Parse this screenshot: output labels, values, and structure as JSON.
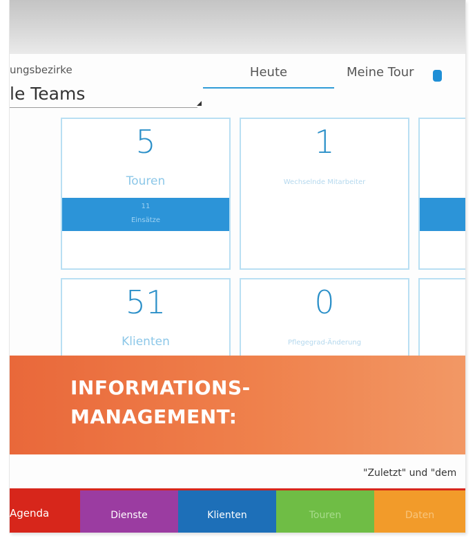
{
  "filter": {
    "label": "ungsbezirke",
    "value": "le Teams"
  },
  "tabs": {
    "heute": "Heute",
    "meine_tour": "Meine Tour"
  },
  "tiles": [
    {
      "number": "5",
      "label": "Touren",
      "band_line1": "11",
      "band_line2": "Einsätze"
    },
    {
      "number": "1",
      "label": "Wechselnde Mitarbeiter"
    },
    {
      "number": "51",
      "label": "Klienten"
    },
    {
      "number": "0",
      "label": "Pflegegrad-Änderung"
    }
  ],
  "banner": {
    "line1": "INFORMATIONS-",
    "line2": "MANAGEMENT:"
  },
  "note": "\"Zuletzt\" und \"dem",
  "nav": {
    "agenda": "Agenda",
    "dienste": "Dienste",
    "klienten": "Klienten",
    "touren": "Touren",
    "daten": "Daten"
  },
  "colors": {
    "accent_blue": "#2c94d8",
    "banner_orange": "#ef814c",
    "nav_agenda": "#d7261b",
    "nav_dienste": "#9b3ca1",
    "nav_klienten": "#1d6fb8",
    "nav_touren": "#6fbd45",
    "nav_daten": "#f29b2a"
  }
}
